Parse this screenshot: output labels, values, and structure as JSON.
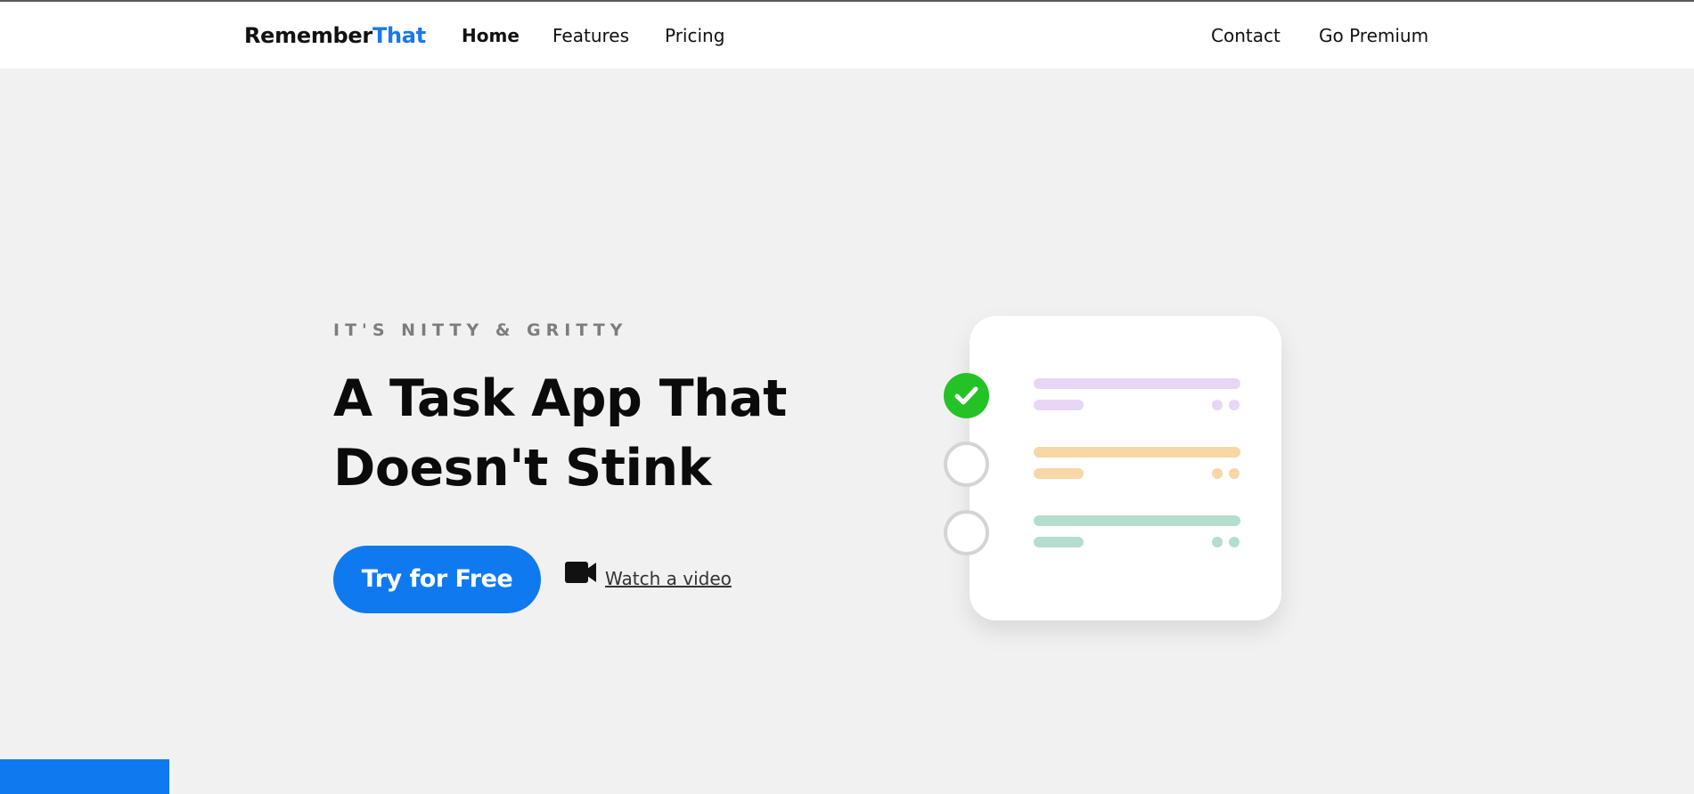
{
  "brand": {
    "name_part1": "Remember",
    "name_part2": "That",
    "accent_color": "#1a78ee"
  },
  "nav": {
    "home": "Home",
    "features": "Features",
    "pricing": "Pricing",
    "contact": "Contact",
    "premium": "Go Premium"
  },
  "hero": {
    "kicker": "IT'S NITTY & GRITTY",
    "title": "A Task App That Doesn't Stink",
    "cta_label": "Try for Free",
    "video_label": "Watch a video"
  },
  "task_card": {
    "tasks": [
      {
        "status": "done",
        "color": "#e8d6f5"
      },
      {
        "status": "todo",
        "color": "#f8d6a6"
      },
      {
        "status": "todo",
        "color": "#b5ddcd"
      }
    ],
    "check_color": "#25c227",
    "icons": [
      "check-icon",
      "empty-circle-icon",
      "empty-circle-icon"
    ]
  },
  "colors": {
    "primary_button": "#0f7af0",
    "background": "#f1f1f1"
  }
}
